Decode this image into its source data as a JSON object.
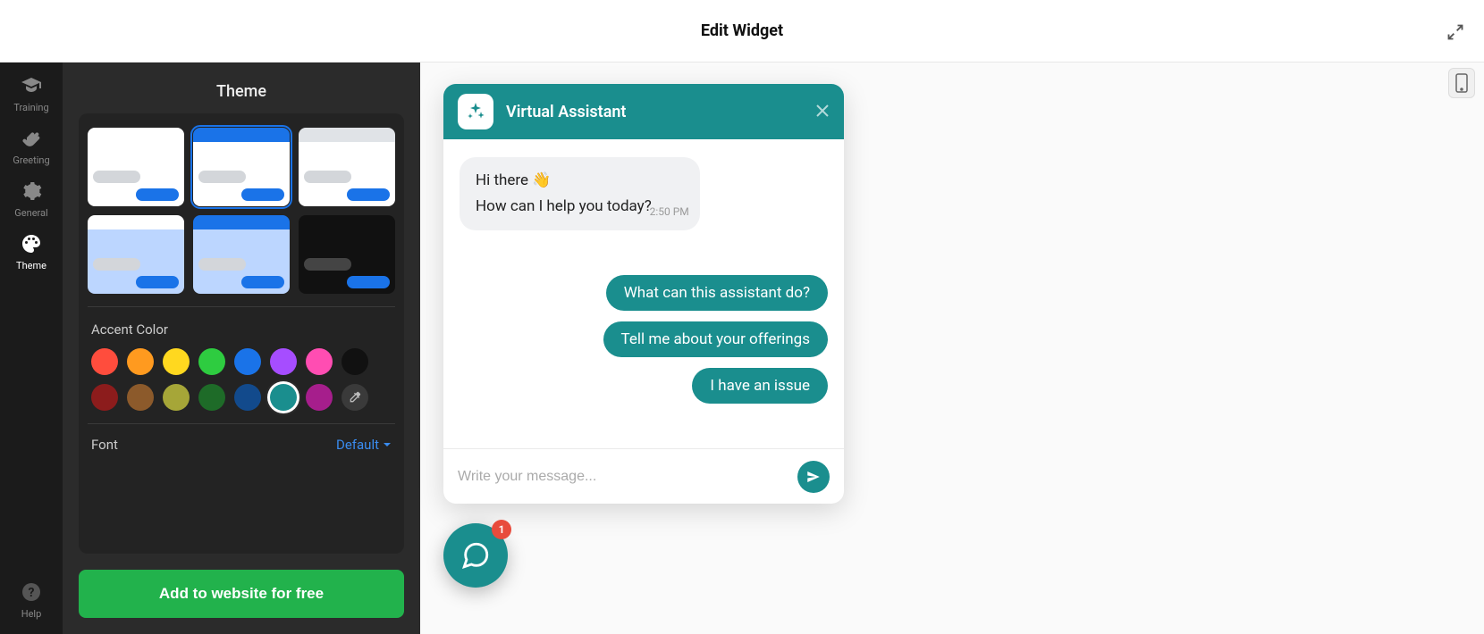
{
  "header": {
    "title": "Edit Widget"
  },
  "rail": {
    "items": [
      {
        "label": "Training"
      },
      {
        "label": "Greeting"
      },
      {
        "label": "General"
      },
      {
        "label": "Theme"
      }
    ],
    "help_label": "Help"
  },
  "panel": {
    "title": "Theme",
    "accent_label": "Accent Color",
    "font_label": "Font",
    "font_value": "Default"
  },
  "themes": {
    "selected_index": 1,
    "items": [
      {
        "head": "#ffffff",
        "body": "#ffffff"
      },
      {
        "head": "#1a73e8",
        "body": "#ffffff"
      },
      {
        "head": "#e0e3e7",
        "body": "#ffffff"
      },
      {
        "head": "#ffffff",
        "body": "#bcd6ff"
      },
      {
        "head": "#1a73e8",
        "body": "#bcd6ff"
      },
      {
        "head": "#111111",
        "body": "#111111"
      }
    ]
  },
  "accent_colors": {
    "selected_index": 13,
    "values": [
      "#ff4d3d",
      "#ff9a1f",
      "#ffd81f",
      "#2ecc40",
      "#1a73e8",
      "#a64dff",
      "#ff4db2",
      "#111111",
      "#8c1c1c",
      "#8c5a2b",
      "#a6a638",
      "#1e6b28",
      "#124a8c",
      "#1a8e8e",
      "#a61e8c"
    ]
  },
  "cta": {
    "label": "Add to website for free"
  },
  "chat": {
    "title": "Virtual Assistant",
    "greet_line1": "Hi there 👋",
    "greet_line2": "How can I help you today?",
    "timestamp": "2:50 PM",
    "suggestions": [
      "What can this assistant do?",
      "Tell me about your offerings",
      "I have an issue"
    ],
    "input_placeholder": "Write your message...",
    "badge_count": "1"
  }
}
